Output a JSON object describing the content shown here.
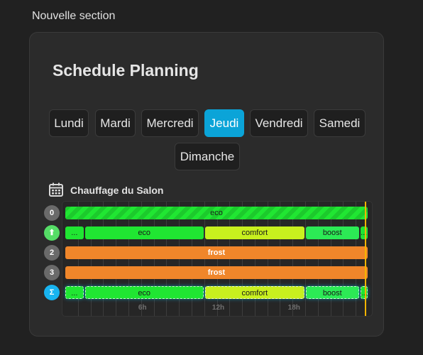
{
  "section": {
    "title": "Nouvelle section"
  },
  "card": {
    "title": "Schedule Planning"
  },
  "days": [
    {
      "label": "Lundi",
      "active": false
    },
    {
      "label": "Mardi",
      "active": false
    },
    {
      "label": "Mercredi",
      "active": false
    },
    {
      "label": "Jeudi",
      "active": true
    },
    {
      "label": "Vendredi",
      "active": false
    },
    {
      "label": "Samedi",
      "active": false
    },
    {
      "label": "Dimanche",
      "active": false
    }
  ],
  "schedule": {
    "icon": "calendar-icon",
    "title": "Chauffage du Salon",
    "hour_labels": [
      "6h",
      "12h",
      "18h"
    ],
    "current_time_hours": 23.7,
    "colors": {
      "eco": "#20e632",
      "comfort": "#c8f01e",
      "boost": "#2cea55",
      "frost": "#f0862a",
      "accent": "#0ba4d8",
      "now": "#f5b400"
    },
    "rows": [
      {
        "badge": "0",
        "badge_color": "#6a6a6a",
        "segments": [
          {
            "label": "eco",
            "mode": "eco",
            "start": 0,
            "end": 24,
            "striped": true
          }
        ]
      },
      {
        "badge": "⬆",
        "badge_color": "#55dd66",
        "segments": [
          {
            "label": "...",
            "mode": "eco",
            "start": 0,
            "end": 1.5
          },
          {
            "label": "eco",
            "mode": "eco",
            "start": 1.5,
            "end": 11
          },
          {
            "label": "comfort",
            "mode": "comfort",
            "start": 11,
            "end": 19
          },
          {
            "label": "boost",
            "mode": "boost",
            "start": 19,
            "end": 23.3
          },
          {
            "label": "...",
            "mode": "eco",
            "start": 23.3,
            "end": 24
          }
        ]
      },
      {
        "badge": "2",
        "badge_color": "#6a6a6a",
        "segments": [
          {
            "label": "frost",
            "mode": "frost",
            "start": 0,
            "end": 24
          }
        ]
      },
      {
        "badge": "3",
        "badge_color": "#6a6a6a",
        "segments": [
          {
            "label": "frost",
            "mode": "frost",
            "start": 0,
            "end": 24
          }
        ]
      },
      {
        "badge": "Σ",
        "badge_color": "#18b4f0",
        "total": true,
        "segments": [
          {
            "label": "...",
            "mode": "eco",
            "start": 0,
            "end": 1.5
          },
          {
            "label": "eco",
            "mode": "eco",
            "start": 1.5,
            "end": 11
          },
          {
            "label": "comfort",
            "mode": "comfort",
            "start": 11,
            "end": 19
          },
          {
            "label": "boost",
            "mode": "boost",
            "start": 19,
            "end": 23.3
          },
          {
            "label": "...",
            "mode": "eco",
            "start": 23.3,
            "end": 24
          }
        ]
      }
    ]
  }
}
